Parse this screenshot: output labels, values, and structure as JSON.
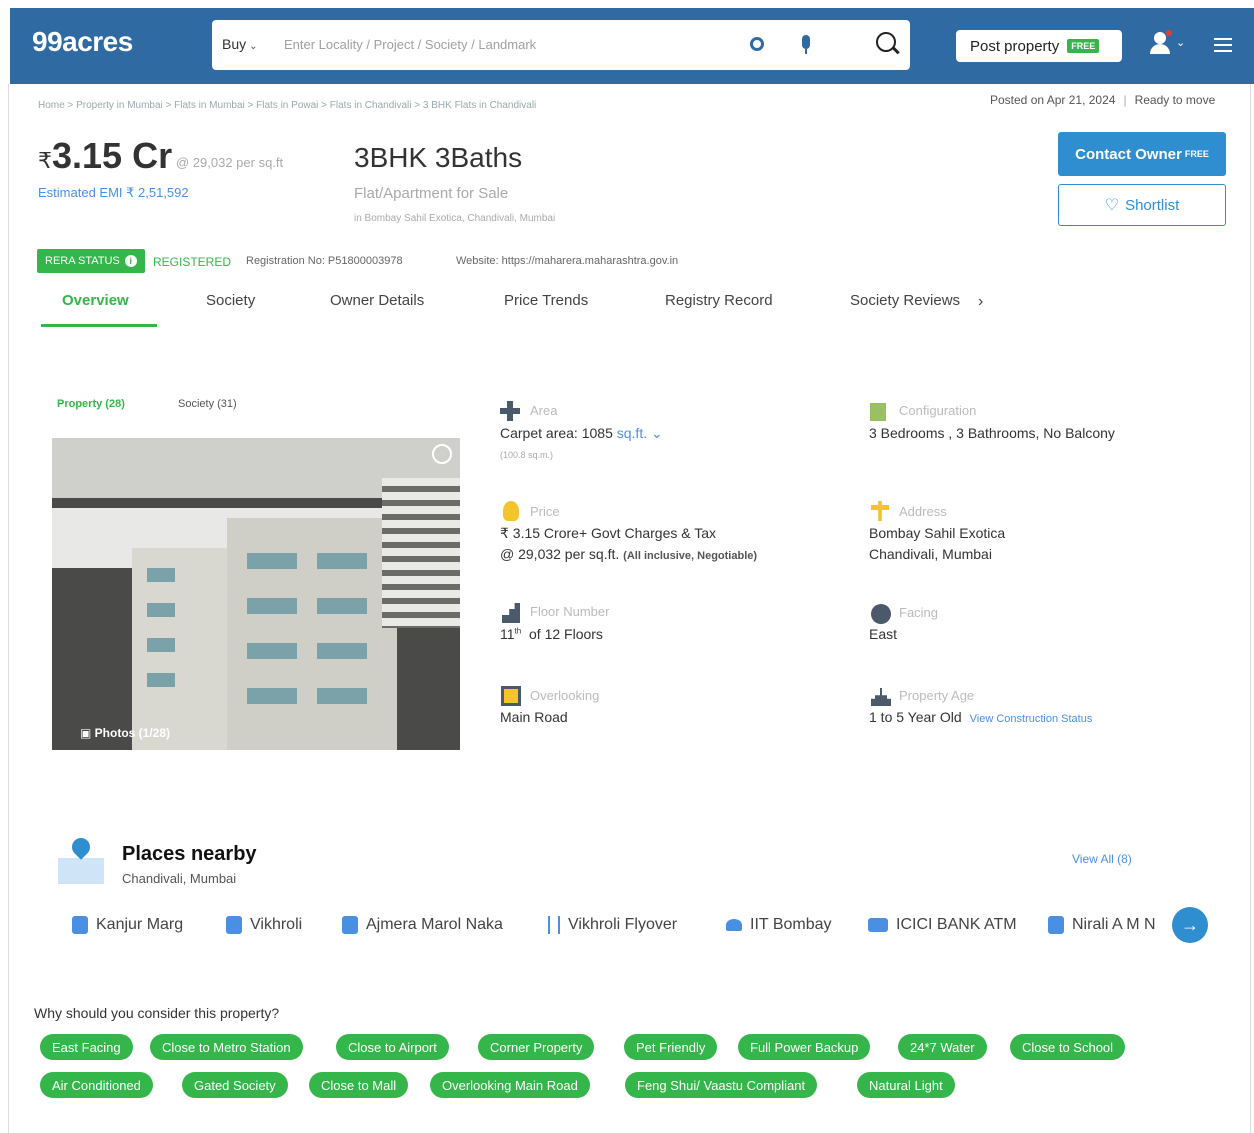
{
  "header": {
    "logo": "99acres",
    "buy_label": "Buy",
    "search_placeholder": "Enter Locality / Project / Society / Landmark",
    "post_property_label": "Post property",
    "post_free_badge": "FREE"
  },
  "breadcrumb": "Home > Property in Mumbai > Flats in Mumbai > Flats in Powai > Flats in Chandivali > 3 BHK Flats in Chandivali",
  "posted": {
    "date": "Posted on Apr 21, 2024",
    "status": "Ready to move"
  },
  "listing": {
    "price": "3.15 Cr",
    "currency": "₹",
    "per_sqft": "@ 29,032 per sq.ft",
    "emi": "Estimated EMI ₹ 2,51,592",
    "title": "3BHK 3Baths",
    "subtitle": "Flat/Apartment for Sale",
    "location": "in Bombay Sahil Exotica, Chandivali, Mumbai"
  },
  "actions": {
    "contact_label": "Contact Owner",
    "contact_badge": "FREE",
    "shortlist_label": "Shortlist"
  },
  "rera": {
    "badge": "RERA STATUS",
    "status": "REGISTERED",
    "registration": "Registration No: P51800003978",
    "website": "Website: https://maharera.maharashtra.gov.in"
  },
  "tabs": [
    "Overview",
    "Society",
    "Owner Details",
    "Price Trends",
    "Registry Record",
    "Society Reviews"
  ],
  "photo_tabs": {
    "property": "Property (28)",
    "society": "Society (31)"
  },
  "photo": {
    "label": "Photos (1/28)"
  },
  "details": {
    "area": {
      "label": "Area",
      "value": "Carpet area: 1085",
      "unit": "sq.ft.",
      "sub": "(100.8 sq.m.)"
    },
    "configuration": {
      "label": "Configuration",
      "value": "3 Bedrooms , 3 Bathrooms, No Balcony"
    },
    "price": {
      "label": "Price",
      "value": "₹ 3.15 Crore+ Govt Charges & Tax",
      "value2": "@ 29,032 per sq.ft.",
      "note": "(All inclusive, Negotiable)"
    },
    "address": {
      "label": "Address",
      "value": "Bombay Sahil Exotica",
      "value2": "Chandivali, Mumbai"
    },
    "floor": {
      "label": "Floor Number",
      "value": "11",
      "suffix": "th",
      "value2": "of 12 Floors"
    },
    "facing": {
      "label": "Facing",
      "value": "East"
    },
    "overlooking": {
      "label": "Overlooking",
      "value": "Main Road"
    },
    "age": {
      "label": "Property Age",
      "value": "1 to 5 Year Old",
      "link": "View Construction Status"
    }
  },
  "places": {
    "title": "Places nearby",
    "subtitle": "Chandivali, Mumbai",
    "view_all": "View All (8)",
    "items": [
      "Kanjur Marg",
      "Vikhroli",
      "Ajmera Marol Naka",
      "Vikhroli Flyover",
      "IIT Bombay",
      "ICICI BANK ATM",
      "Nirali A M N"
    ]
  },
  "why": {
    "title": "Why should you consider this property?",
    "chips": [
      "East Facing",
      "Close to Metro Station",
      "Close to Airport",
      "Corner Property",
      "Pet Friendly",
      "Full Power Backup",
      "24*7 Water",
      "Close to School",
      "Air Conditioned",
      "Gated Society",
      "Close to Mall",
      "Overlooking Main Road",
      "Feng Shui/ Vaastu Compliant",
      "Natural Light"
    ]
  },
  "colors": {
    "header": "#2f6aa3",
    "accent_green": "#35b64a",
    "accent_blue": "#2f8ed0"
  }
}
